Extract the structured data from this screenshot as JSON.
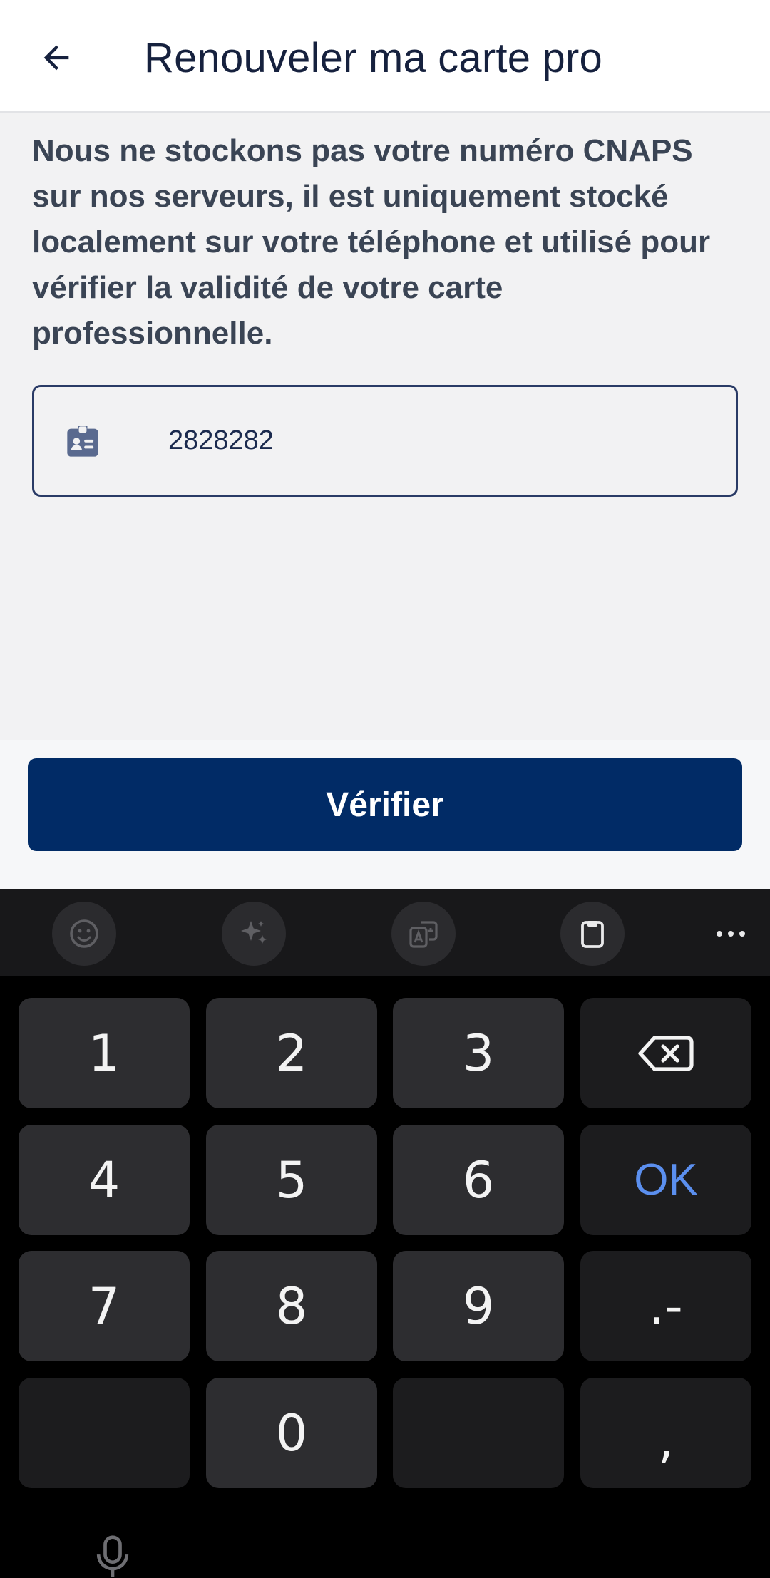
{
  "app_bar": {
    "back_icon": "arrow-left-icon",
    "title": "Renouveler ma carte pro"
  },
  "info": {
    "text": "Nous ne stockons pas votre numéro CNAPS sur nos serveurs, il est uniquement stocké localement sur votre téléphone et utilisé pour vérifier la validité de votre carte professionnelle."
  },
  "cnaps_input": {
    "icon": "id-badge-icon",
    "value": "2828282"
  },
  "actions": {
    "verify_label": "Vérifier"
  },
  "keyboard": {
    "toolbar": [
      "emoji-icon",
      "sparkle-icon",
      "translate-icon",
      "clipboard-icon",
      "more-icon"
    ],
    "keys": {
      "k1": "1",
      "k2": "2",
      "k3": "3",
      "k4": "4",
      "k5": "5",
      "k6": "6",
      "k7": "7",
      "k8": "8",
      "k9": "9",
      "k0": "0",
      "ok": "OK",
      "dot_dash": ".-",
      "comma": ","
    },
    "backspace_icon": "backspace-icon",
    "mic_icon": "microphone-icon"
  },
  "colors": {
    "primary": "#012b66",
    "title": "#16213e",
    "body_text": "#3a4454",
    "ok_key": "#5b8fef"
  }
}
